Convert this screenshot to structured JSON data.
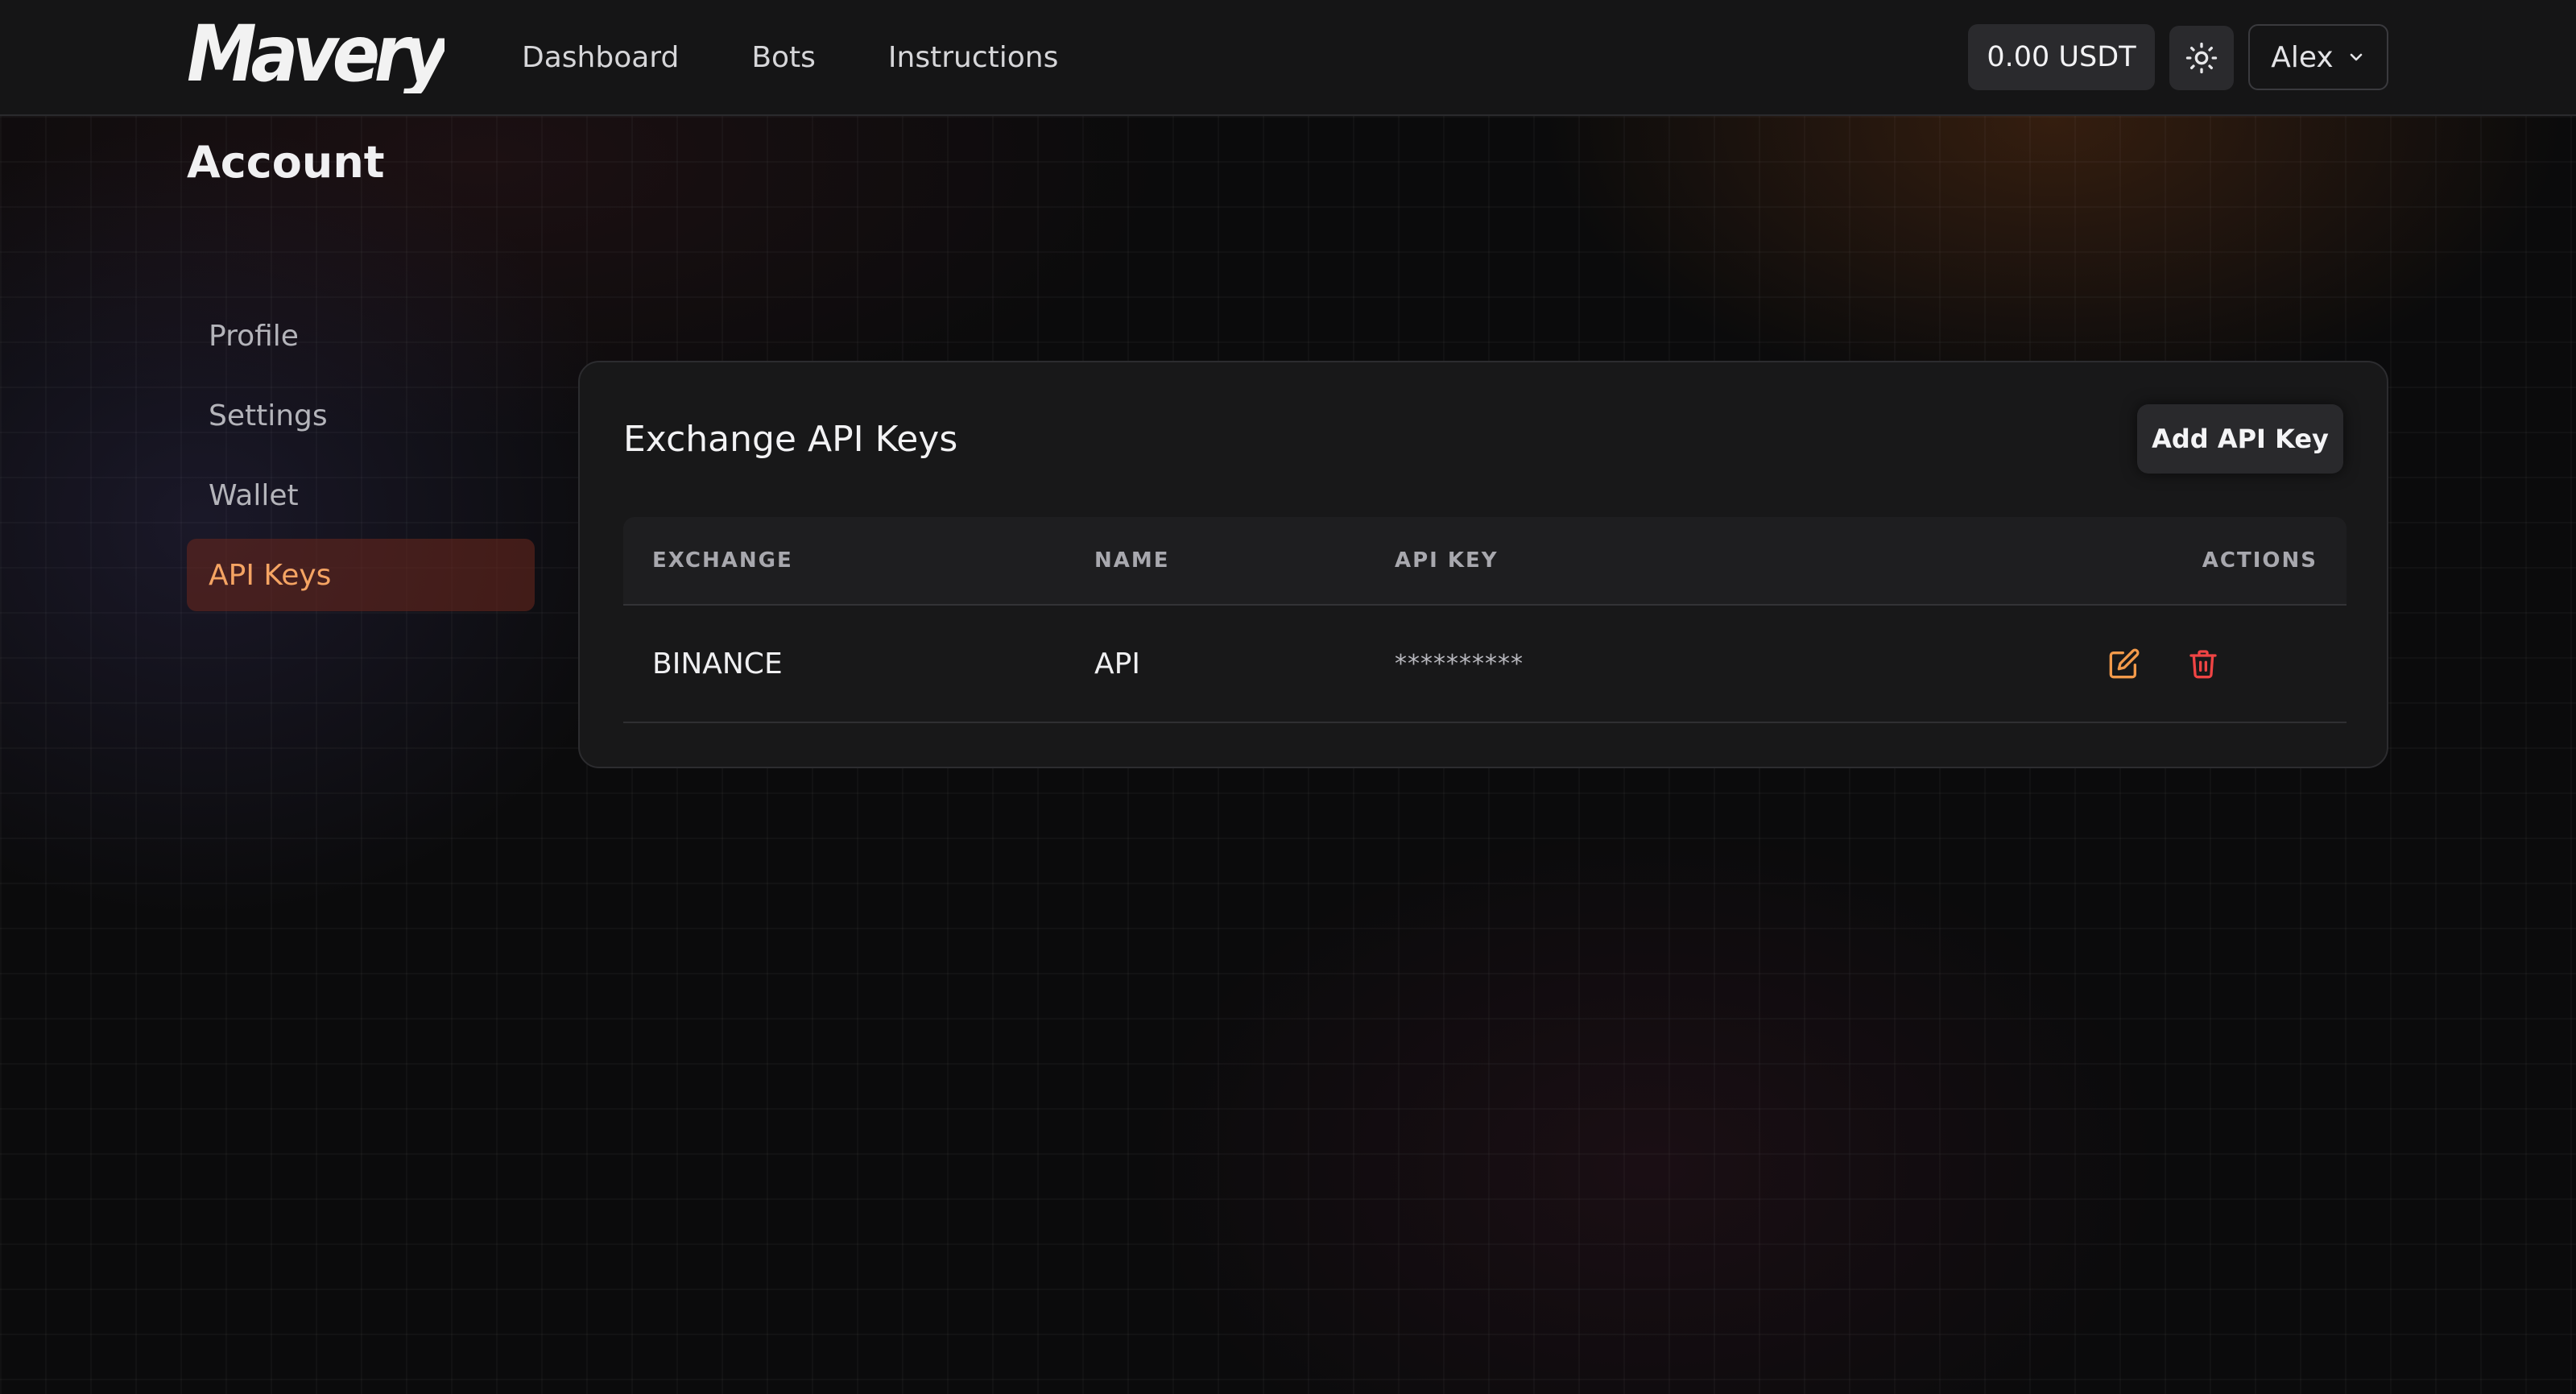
{
  "header": {
    "brand": "Mavery",
    "nav": [
      "Dashboard",
      "Bots",
      "Instructions"
    ],
    "balance": "0.00 USDT",
    "user_name": "Alex",
    "theme_icon": "sun-icon",
    "user_menu_icon": "chevron-down-icon"
  },
  "page": {
    "title": "Account"
  },
  "sidebar": {
    "items": [
      {
        "label": "Profile",
        "active": false
      },
      {
        "label": "Settings",
        "active": false
      },
      {
        "label": "Wallet",
        "active": false
      },
      {
        "label": "API Keys",
        "active": true
      }
    ]
  },
  "api_keys": {
    "title": "Exchange API Keys",
    "add_button": "Add API Key",
    "columns": [
      "EXCHANGE",
      "NAME",
      "API KEY",
      "ACTIONS"
    ],
    "rows": [
      {
        "exchange": "BINANCE",
        "name": "API",
        "api_key": "**********",
        "actions": [
          "edit-icon",
          "trash-icon"
        ]
      }
    ]
  },
  "colors": {
    "accent": "#f5a463",
    "danger": "#ef4444",
    "edit_icon": "#f39a4a"
  }
}
